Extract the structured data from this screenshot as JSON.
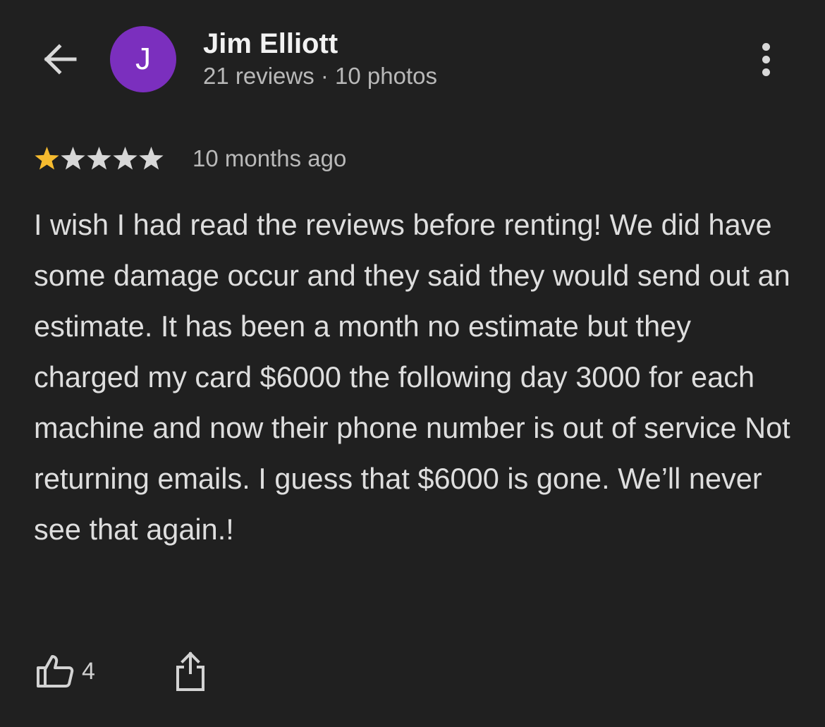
{
  "header": {
    "back_icon": "arrow-left-icon",
    "avatar_initial": "J",
    "avatar_color": "#7b2fbe",
    "user_name": "Jim Elliott",
    "user_meta": "21 reviews · 10 photos",
    "more_icon": "more-vertical-icon"
  },
  "review": {
    "rating": 1,
    "max_rating": 5,
    "star_filled_color": "#f6bb2f",
    "star_empty_color": "#d7d7d7",
    "time": "10 months ago",
    "text": "I wish I had read the reviews before renting! We did have some damage occur and they said they would send out an estimate. It has been a month no estimate but they charged my card $6000 the following day 3000 for each machine and now their phone number is out of service Not returning emails. I guess that $6000 is gone. We’ll never see that again.!"
  },
  "actions": {
    "like_icon": "thumbs-up-icon",
    "like_count": "4",
    "share_icon": "share-icon"
  }
}
